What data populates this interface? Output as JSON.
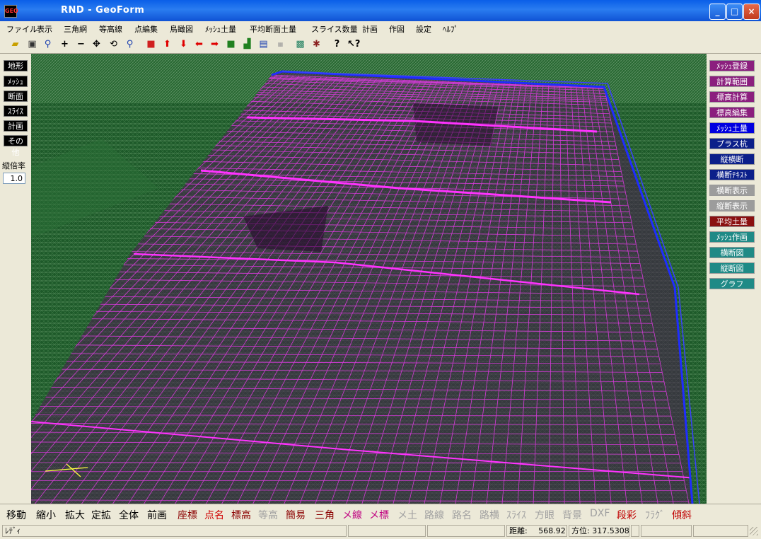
{
  "window": {
    "title": "RND - GeoForm",
    "icon_text": "GEO",
    "minimize": "_",
    "maximize": "□",
    "close": "×"
  },
  "menu": [
    "ファイル",
    "表示",
    "三角網",
    "等高線",
    "点編集",
    "鳥瞰図",
    "ﾒｯｼｭ土量",
    "平均断面土量",
    "スライス数量",
    "計画",
    "作図",
    "設定",
    "ﾍﾙﾌﾟ"
  ],
  "toolbar": {
    "icons": [
      "open-folder-icon",
      "save-icon",
      "zoom-icon",
      "plus-icon",
      "minus-icon",
      "move-cross-icon",
      "rotate-icon",
      "zoom-region-icon",
      "cube-icon",
      "arrow-up-icon",
      "arrow-down-icon",
      "arrow-left-icon",
      "arrow-right-icon",
      "cube-green-icon",
      "chart-icon",
      "window-icon",
      "mesh-label-icon",
      "map-icon",
      "bug-icon",
      "help-icon",
      "context-help-icon"
    ]
  },
  "left_panel": {
    "buttons": [
      "地形",
      "ﾒｯｼｭ",
      "断面",
      "ｽﾗｲｽ",
      "計画",
      "その他"
    ],
    "scale_label": "縦倍率",
    "scale_value": "1.0"
  },
  "right_panel": {
    "buttons": [
      {
        "label": "ﾒｯｼｭ登録",
        "color": "#8b1f7e"
      },
      {
        "label": "計算範囲",
        "color": "#8b1f7e"
      },
      {
        "label": "標高計算",
        "color": "#8b1f7e"
      },
      {
        "label": "標高編集",
        "color": "#8b1f7e"
      },
      {
        "label": "ﾒｯｼｭ土量",
        "color": "#0000e0"
      },
      {
        "label": "プラス杭",
        "color": "#0b1f8a"
      },
      {
        "label": "縦横断",
        "color": "#0b1f8a"
      },
      {
        "label": "横断ﾃｷｽﾄ",
        "color": "#0b1f8a"
      },
      {
        "label": "横断表示",
        "color": "#9c9c9c"
      },
      {
        "label": "縦断表示",
        "color": "#9c9c9c"
      },
      {
        "label": "平均土量",
        "color": "#8a1010"
      },
      {
        "label": "ﾒｯｼｭ作画",
        "color": "#1f8a86"
      },
      {
        "label": "横断図",
        "color": "#1f8a86"
      },
      {
        "label": "縦断図",
        "color": "#1f8a86"
      },
      {
        "label": "グラフ",
        "color": "#1f8a86"
      }
    ]
  },
  "bottom_bar": [
    {
      "label": "移動",
      "color": "#000000"
    },
    {
      "label": "縮小",
      "color": "#000000"
    },
    {
      "label": "拡大",
      "color": "#000000"
    },
    {
      "label": "定拡",
      "color": "#000000"
    },
    {
      "label": "全体",
      "color": "#000000"
    },
    {
      "label": "前画",
      "color": "#000000"
    },
    {
      "label": "座標",
      "color": "#8b0000"
    },
    {
      "label": "点名",
      "color": "#d00000"
    },
    {
      "label": "標高",
      "color": "#8b0000"
    },
    {
      "label": "等高",
      "color": "#a0a0a0"
    },
    {
      "label": "簡易",
      "color": "#8b0000"
    },
    {
      "label": "三角",
      "color": "#8b0000"
    },
    {
      "label": "メ線",
      "color": "#c00080"
    },
    {
      "label": "メ標",
      "color": "#c00080"
    },
    {
      "label": "メ土",
      "color": "#a0a0a0"
    },
    {
      "label": "路線",
      "color": "#a0a0a0"
    },
    {
      "label": "路名",
      "color": "#a0a0a0"
    },
    {
      "label": "路横",
      "color": "#a0a0a0"
    },
    {
      "label": "ｽﾗｲｽ",
      "color": "#a0a0a0"
    },
    {
      "label": "方眼",
      "color": "#a0a0a0"
    },
    {
      "label": "背景",
      "color": "#a0a0a0"
    },
    {
      "label": "DXF",
      "color": "#a0a0a0"
    },
    {
      "label": "段彩",
      "color": "#c00000"
    },
    {
      "label": "ﾌﾗｸﾞ",
      "color": "#a0a0a0"
    },
    {
      "label": "傾斜",
      "color": "#c00000"
    }
  ],
  "status": {
    "ready": "ﾚﾃﾞｨ",
    "distance_label": "距離:",
    "distance_value": "568.921",
    "azimuth_label": "方位:",
    "azimuth_value": "317.5308"
  },
  "colors": {
    "terrain": "#1e5a2a",
    "mesh": "#d43ad8",
    "boundary": "#1f2cff"
  }
}
